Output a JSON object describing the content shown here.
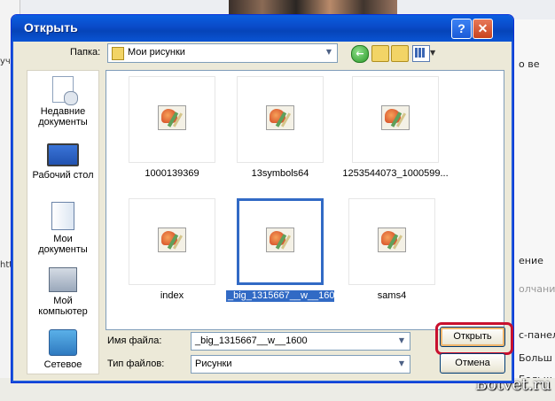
{
  "dialog": {
    "title": "Открыть",
    "help": "?",
    "close": "✕"
  },
  "toolbar": {
    "folder_label": "Папка:",
    "folder_value": "Мои рисунки"
  },
  "places": [
    {
      "label": "Недавние документы",
      "icon": "recent-documents-icon"
    },
    {
      "label": "Рабочий стол",
      "icon": "desktop-icon"
    },
    {
      "label": "Мои документы",
      "icon": "my-documents-icon"
    },
    {
      "label": "Мой компьютер",
      "icon": "my-computer-icon"
    },
    {
      "label": "Сетевое",
      "icon": "network-icon"
    }
  ],
  "files": [
    {
      "name": "1000139369",
      "selected": false
    },
    {
      "name": "13symbols64",
      "selected": false
    },
    {
      "name": "1253544073_1000599...",
      "selected": false
    },
    {
      "name": "index",
      "selected": false
    },
    {
      "name": "_big_1315667__w__1600",
      "selected": true
    },
    {
      "name": "sams4",
      "selected": false
    }
  ],
  "form": {
    "filename_label": "Имя файла:",
    "filename_value": "_big_1315667__w__1600",
    "filetype_label": "Тип файлов:",
    "filetype_value": "Рисунки",
    "open_button": "Открыть",
    "cancel_button": "Отмена"
  },
  "background": {
    "right_texts": [
      "о ве",
      "ение",
      "олчанию",
      "с-панели",
      "Больш",
      "Больш"
    ],
    "left_texts": [
      "учат",
      "http"
    ],
    "watermark": "Botvet.ru"
  },
  "colors": {
    "titlebar": "#0a4ac8",
    "selection": "#316ac5",
    "highlight": "#c8102e"
  }
}
